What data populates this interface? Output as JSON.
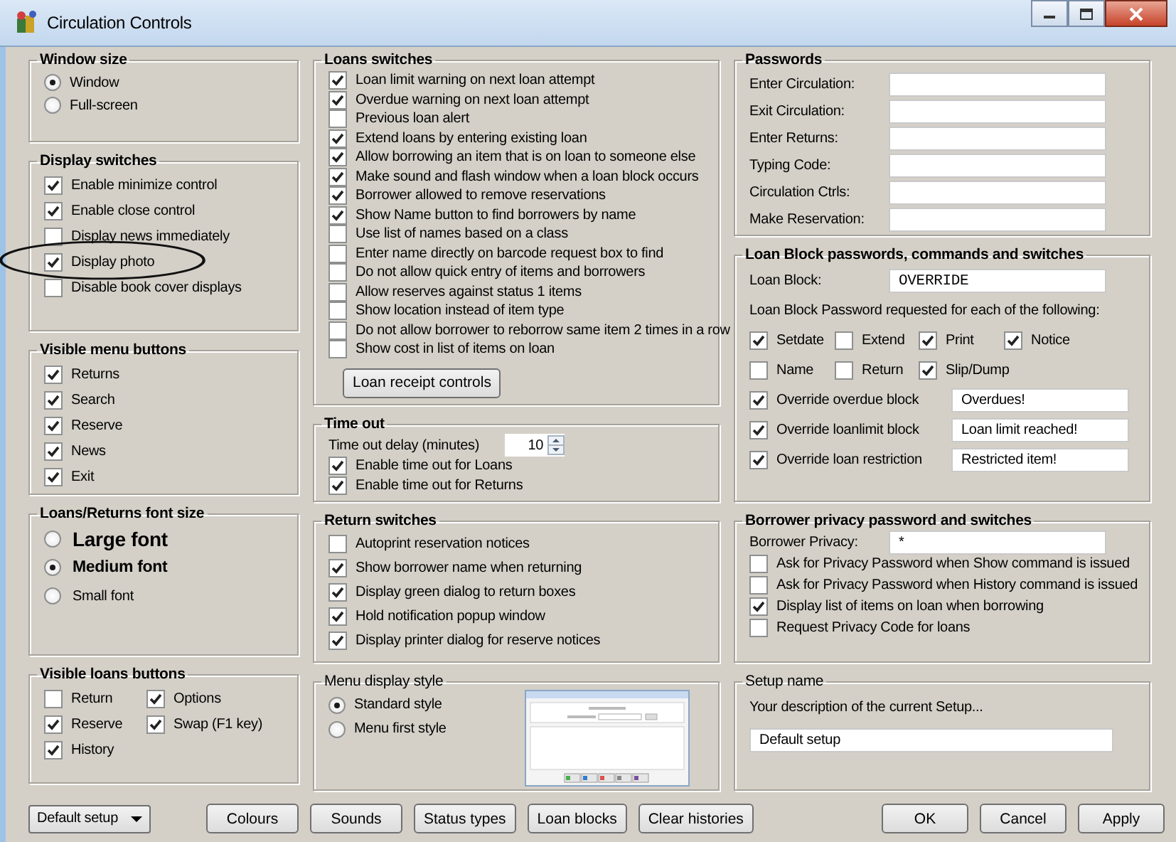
{
  "window": {
    "title": "Circulation Controls"
  },
  "columns": [
    {
      "groups": [
        {
          "title": "Window size",
          "bold_title": true,
          "items": [
            {
              "kind": "radio",
              "label": "Window",
              "selected": true
            },
            {
              "kind": "radio",
              "label": "Full-screen",
              "selected": false
            }
          ]
        },
        {
          "title": "Display switches",
          "bold_title": true,
          "items": [
            {
              "kind": "checkbox",
              "label": "Enable minimize control",
              "checked": true,
              "circled": false
            },
            {
              "kind": "checkbox",
              "label": "Enable close control",
              "checked": true,
              "circled": false
            },
            {
              "kind": "checkbox",
              "label": "Display news immediately",
              "checked": false,
              "circled": false
            },
            {
              "kind": "checkbox",
              "label": "Display photo",
              "checked": true,
              "circled": true
            },
            {
              "kind": "checkbox",
              "label": "Disable book cover displays",
              "checked": false,
              "circled": false
            }
          ]
        },
        {
          "title": "Visible menu buttons",
          "bold_title": true,
          "items": [
            {
              "kind": "checkbox",
              "label": "Returns",
              "checked": true
            },
            {
              "kind": "checkbox",
              "label": "Search",
              "checked": true
            },
            {
              "kind": "checkbox",
              "label": "Reserve",
              "checked": true
            },
            {
              "kind": "checkbox",
              "label": "News",
              "checked": true
            },
            {
              "kind": "checkbox",
              "label": "Exit",
              "checked": true
            }
          ]
        },
        {
          "title": "Loans/Returns font size",
          "bold_title": true,
          "items": [
            {
              "kind": "large_radio",
              "label": "Large font",
              "selected": false
            },
            {
              "kind": "medium_radio",
              "label": "Medium font",
              "selected": true
            },
            {
              "kind": "radio",
              "label": "Small font",
              "selected": false
            }
          ]
        },
        {
          "title": "Visible loans buttons",
          "bold_title": true,
          "items": [
            {
              "kind": "checkgrid",
              "rows": [
                [
                  {
                    "label": "Return",
                    "checked": false
                  },
                  {
                    "label": "Options",
                    "checked": true
                  }
                ],
                [
                  {
                    "label": "Reserve",
                    "checked": true
                  },
                  {
                    "label": "Swap (F1 key)",
                    "checked": true
                  }
                ],
                [
                  {
                    "label": "History",
                    "checked": true
                  }
                ]
              ]
            }
          ]
        }
      ]
    },
    {
      "groups": [
        {
          "title": "Loans switches",
          "bold_title": true,
          "items": [
            {
              "kind": "checkbox",
              "label": "Loan limit warning on next loan attempt",
              "checked": true
            },
            {
              "kind": "checkbox",
              "label": "Overdue warning on next loan attempt",
              "checked": true
            },
            {
              "kind": "checkbox",
              "label": "Previous loan alert",
              "checked": false
            },
            {
              "kind": "checkbox",
              "label": "Extend loans by entering existing loan",
              "checked": true
            },
            {
              "kind": "checkbox",
              "label": "Allow borrowing an item that is on loan to someone else",
              "checked": true
            },
            {
              "kind": "checkbox",
              "label": "Make sound and flash window when a loan block occurs",
              "checked": true
            },
            {
              "kind": "checkbox",
              "label": "Borrower allowed to remove reservations",
              "checked": true
            },
            {
              "kind": "checkbox",
              "label": "Show Name button to find borrowers by name",
              "checked": true
            },
            {
              "kind": "checkbox",
              "label": "Use list of names based on a class",
              "checked": false
            },
            {
              "kind": "checkbox",
              "label": "Enter name directly on barcode request box to find",
              "checked": false
            },
            {
              "kind": "checkbox",
              "label": "Do not allow quick entry of items and borrowers",
              "checked": false
            },
            {
              "kind": "checkbox",
              "label": "Allow reserves against status 1 items",
              "checked": false
            },
            {
              "kind": "checkbox",
              "label": "Show location instead of item type",
              "checked": false
            },
            {
              "kind": "checkbox",
              "label": "Do not allow borrower to reborrow same item 2 times in a row",
              "checked": false
            },
            {
              "kind": "checkbox",
              "label": "Show cost in list of items on loan",
              "checked": false
            },
            {
              "kind": "button",
              "label": "Loan receipt controls"
            }
          ]
        },
        {
          "title": "Time out",
          "bold_title": true,
          "items": [
            {
              "kind": "spin",
              "label": "Time out delay (minutes)",
              "value": "10"
            },
            {
              "kind": "checkbox",
              "label": "Enable time out for Loans",
              "checked": true
            },
            {
              "kind": "checkbox",
              "label": "Enable time out for Returns",
              "checked": true
            }
          ]
        },
        {
          "title": "Return switches",
          "bold_title": true,
          "items": [
            {
              "kind": "checkbox",
              "label": "Autoprint reservation notices",
              "checked": false
            },
            {
              "kind": "checkbox",
              "label": "Show borrower name when returning",
              "checked": true
            },
            {
              "kind": "checkbox",
              "label": "Display green dialog to return boxes",
              "checked": true
            },
            {
              "kind": "checkbox",
              "label": "Hold notification popup window",
              "checked": true
            },
            {
              "kind": "checkbox",
              "label": "Display printer dialog for reserve notices",
              "checked": true
            }
          ]
        },
        {
          "title": "Menu display style",
          "bold_title": false,
          "items": [
            {
              "kind": "radio",
              "label": "Standard style",
              "selected": true
            },
            {
              "kind": "radio",
              "label": "Menu first style",
              "selected": false
            },
            {
              "kind": "preview"
            }
          ]
        }
      ]
    },
    {
      "groups": [
        {
          "title": "Passwords",
          "bold_title": true,
          "items": [
            {
              "kind": "field",
              "label": "Enter Circulation:"
            },
            {
              "kind": "field",
              "label": "Exit Circulation:"
            },
            {
              "kind": "field",
              "label": "Enter Returns:"
            },
            {
              "kind": "field",
              "label": "Typing Code:"
            },
            {
              "kind": "field",
              "label": "Circulation Ctrls:"
            },
            {
              "kind": "field",
              "label": "Make Reservation:"
            }
          ]
        },
        {
          "title": "Loan Block passwords, commands and switches",
          "bold_title": true,
          "items": [
            {
              "kind": "field",
              "label": "Loan Block:",
              "value": "OVERRIDE"
            },
            {
              "kind": "text",
              "text": "Loan Block Password requested for each of the following:"
            },
            {
              "kind": "checkgrid",
              "rows": [
                [
                  {
                    "label": "Setdate",
                    "checked": true
                  },
                  {
                    "label": "Extend",
                    "checked": false
                  },
                  {
                    "label": "Print",
                    "checked": true
                  },
                  {
                    "label": "Notice",
                    "checked": true
                  }
                ],
                [
                  {
                    "label": "Name",
                    "checked": false
                  },
                  {
                    "label": "Return",
                    "checked": false
                  },
                  {
                    "label": "Slip/Dump",
                    "checked": true
                  }
                ]
              ]
            },
            {
              "kind": "checkfield",
              "label": "Override overdue block",
              "checked": true,
              "value": "Overdues!"
            },
            {
              "kind": "checkfield",
              "label": "Override loanlimit block",
              "checked": true,
              "value": "Loan limit reached!"
            },
            {
              "kind": "checkfield",
              "label": "Override loan restriction",
              "checked": true,
              "value": "Restricted item!"
            }
          ]
        },
        {
          "title": "Borrower privacy password and switches",
          "bold_title": true,
          "items": [
            {
              "kind": "field",
              "label": "Borrower Privacy:",
              "value": "*"
            },
            {
              "kind": "checkbox",
              "label": "Ask for Privacy Password when Show command is issued",
              "checked": false
            },
            {
              "kind": "checkbox",
              "label": "Ask for Privacy Password when History command is issued",
              "checked": false
            },
            {
              "kind": "checkbox",
              "label": "Display list of items on loan when borrowing",
              "checked": true
            },
            {
              "kind": "checkbox",
              "label": "Request Privacy Code for loans",
              "checked": false
            }
          ]
        },
        {
          "title": "Setup name",
          "bold_title": false,
          "items": [
            {
              "kind": "text",
              "text": "Your description of the current Setup..."
            },
            {
              "kind": "wide_field",
              "value": "Default setup"
            }
          ]
        }
      ]
    }
  ],
  "bottom_bar": {
    "setup_dropdown": "Default setup",
    "left_buttons": [
      "Colours",
      "Sounds",
      "Status types",
      "Loan blocks",
      "Clear histories"
    ],
    "right_buttons": [
      "OK",
      "Cancel",
      "Apply"
    ]
  }
}
